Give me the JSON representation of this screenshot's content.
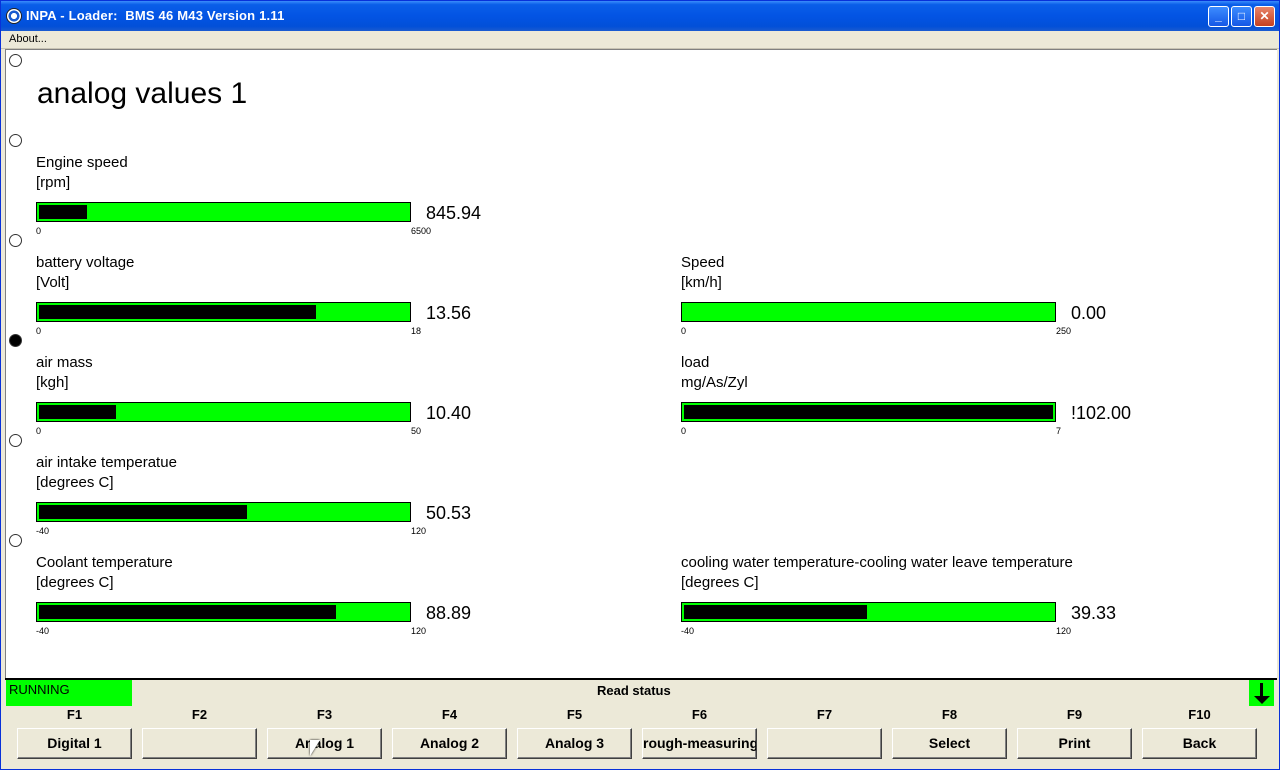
{
  "window": {
    "title": "INPA - Loader:  BMS 46 M43 Version 1.11",
    "menu": [
      "About..."
    ]
  },
  "page": {
    "title": "analog values 1"
  },
  "gauges": [
    {
      "label": "Engine speed",
      "unit": "[rpm]",
      "value": "845.94",
      "min": "0",
      "max": "6500",
      "fill_fraction": 0.13
    },
    {
      "label": "battery voltage",
      "unit": "[Volt]",
      "value": "13.56",
      "min": "0",
      "max": "18",
      "fill_fraction": 0.75
    },
    {
      "label": "Speed",
      "unit": "[km/h]",
      "value": "0.00",
      "min": "0",
      "max": "250",
      "fill_fraction": 0.0
    },
    {
      "label": "air mass",
      "unit": "[kgh]",
      "value": "10.40",
      "min": "0",
      "max": "50",
      "fill_fraction": 0.21
    },
    {
      "label": "load",
      "unit": "mg/As/Zyl",
      "value": "!102.00",
      "min": "0",
      "max": "7",
      "fill_fraction": 1.0
    },
    {
      "label": "air intake temperatue",
      "unit": "[degrees C]",
      "value": "50.53",
      "min": "-40",
      "max": "120",
      "fill_fraction": 0.565
    },
    {
      "label": "Coolant temperature",
      "unit": "[degrees C]",
      "value": "88.89",
      "min": "-40",
      "max": "120",
      "fill_fraction": 0.805
    },
    {
      "label": "cooling water temperature-cooling water leave temperature",
      "unit": "[degrees C]",
      "value": "39.33",
      "min": "-40",
      "max": "120",
      "fill_fraction": 0.495
    }
  ],
  "status": {
    "state": "RUNNING",
    "text": "Read status",
    "state_color": "#00ff00"
  },
  "fkeys": [
    {
      "key": "F1",
      "label": "Digital 1"
    },
    {
      "key": "F2",
      "label": ""
    },
    {
      "key": "F3",
      "label": "Analog 1"
    },
    {
      "key": "F4",
      "label": "Analog 2"
    },
    {
      "key": "F5",
      "label": "Analog 3"
    },
    {
      "key": "F6",
      "label": "rough-measuring"
    },
    {
      "key": "F7",
      "label": ""
    },
    {
      "key": "F8",
      "label": "Select"
    },
    {
      "key": "F9",
      "label": "Print"
    },
    {
      "key": "F10",
      "label": "Back"
    }
  ],
  "colors": {
    "bar_background": "#00ff00",
    "bar_fill": "#000000",
    "titlebar": "#0354e4"
  }
}
